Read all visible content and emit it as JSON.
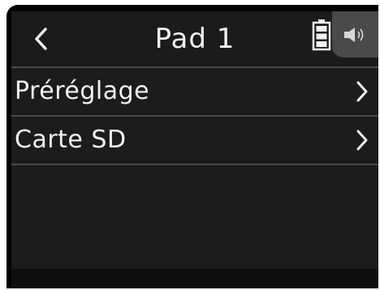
{
  "header": {
    "title": "Pad 1",
    "back_icon": "chevron-left-icon",
    "battery_icon": "battery-icon",
    "speaker_icon": "speaker-icon"
  },
  "menu": {
    "items": [
      {
        "label": "Préréglage",
        "icon": "chevron-right-icon"
      },
      {
        "label": "Carte SD",
        "icon": "chevron-right-icon"
      }
    ]
  },
  "colors": {
    "background": "#1c1c1c",
    "frame": "#000000",
    "text": "#f2f2f2",
    "divider": "#4a4a4a",
    "speaker_button": "#4a4a4a"
  }
}
